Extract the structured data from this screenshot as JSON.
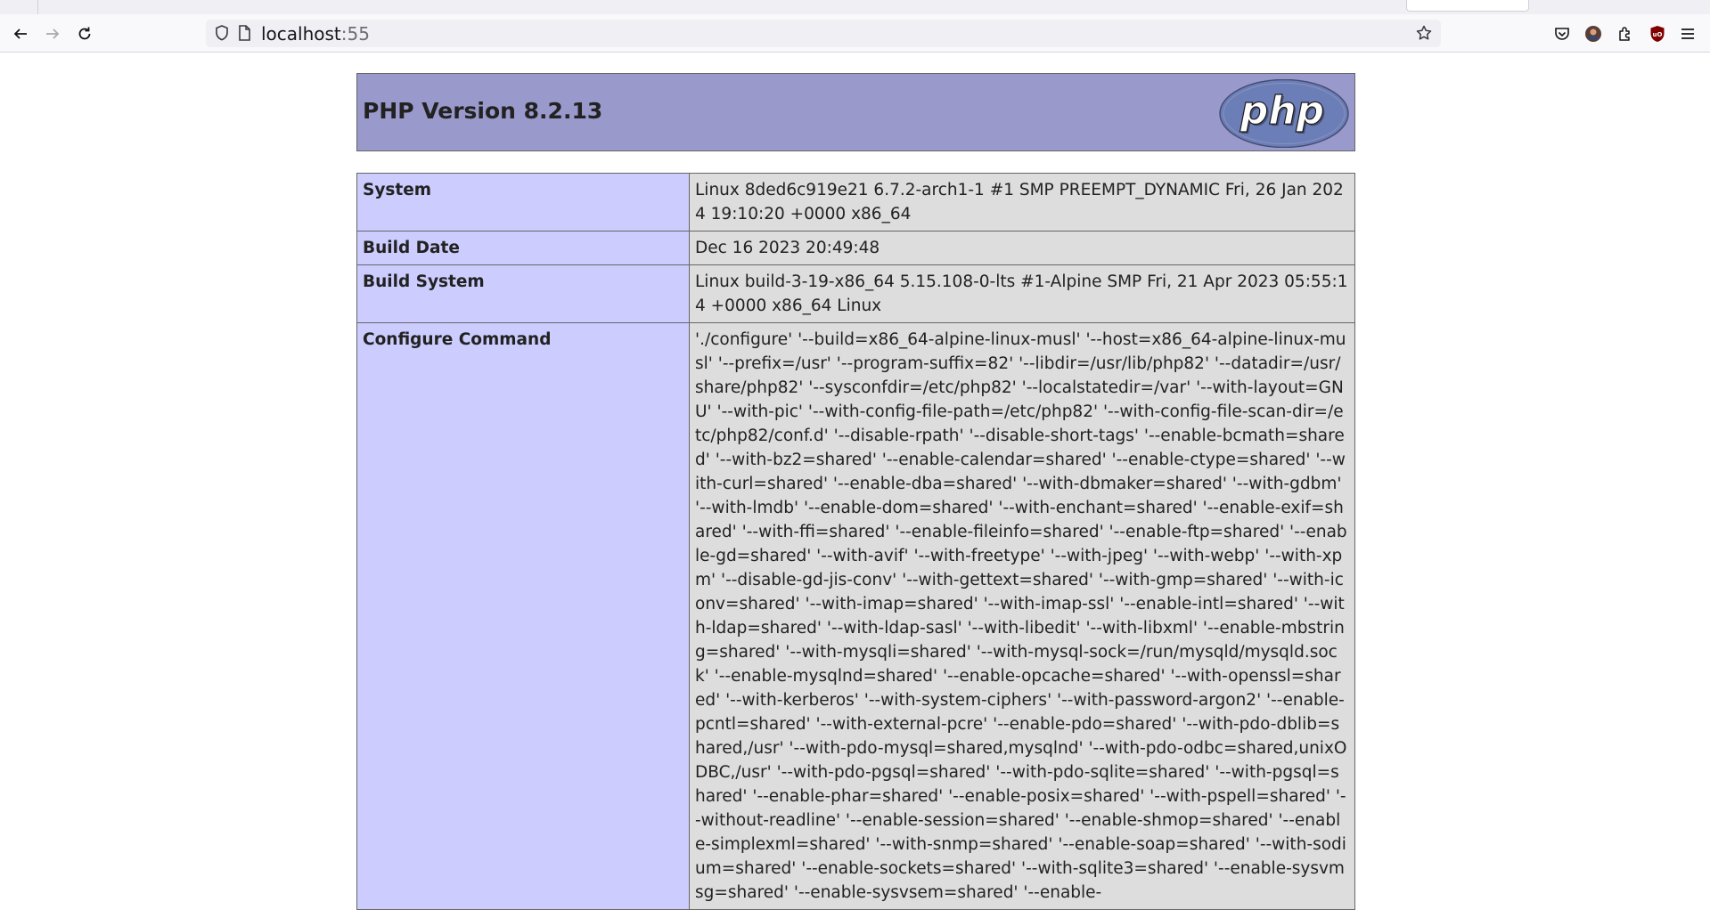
{
  "browser": {
    "url_host": "localhost",
    "url_port": ":55",
    "icons": {
      "back": "arrow-left-icon",
      "forward": "arrow-right-icon",
      "reload": "reload-icon",
      "shield": "tracking-shield-icon",
      "page": "page-info-icon",
      "bookmark": "star-icon",
      "pocket": "pocket-icon",
      "account": "account-avatar-icon",
      "extensions": "extensions-puzzle-icon",
      "ublock": "ublock-origin-icon",
      "menu": "hamburger-menu-icon"
    }
  },
  "phpinfo": {
    "title": "PHP Version 8.2.13",
    "logo_text": "php",
    "colors": {
      "header_bg": "#9999cc",
      "key_bg": "#ccccff",
      "value_bg": "#dddddd",
      "border": "#666666"
    },
    "rows": [
      {
        "key": "System",
        "value": "Linux 8ded6c919e21 6.7.2-arch1-1 #1 SMP PREEMPT_DYNAMIC Fri, 26 Jan 2024 19:10:20 +0000 x86_64"
      },
      {
        "key": "Build Date",
        "value": "Dec 16 2023 20:49:48"
      },
      {
        "key": "Build System",
        "value": "Linux build-3-19-x86_64 5.15.108-0-lts #1-Alpine SMP Fri, 21 Apr 2023 05:55:14 +0000 x86_64 Linux"
      },
      {
        "key": "Configure Command",
        "value": "'./configure' '--build=x86_64-alpine-linux-musl' '--host=x86_64-alpine-linux-musl' '--prefix=/usr' '--program-suffix=82' '--libdir=/usr/lib/php82' '--datadir=/usr/share/php82' '--sysconfdir=/etc/php82' '--localstatedir=/var' '--with-layout=GNU' '--with-pic' '--with-config-file-path=/etc/php82' '--with-config-file-scan-dir=/etc/php82/conf.d' '--disable-rpath' '--disable-short-tags' '--enable-bcmath=shared' '--with-bz2=shared' '--enable-calendar=shared' '--enable-ctype=shared' '--with-curl=shared' '--enable-dba=shared' '--with-dbmaker=shared' '--with-gdbm' '--with-lmdb' '--enable-dom=shared' '--with-enchant=shared' '--enable-exif=shared' '--with-ffi=shared' '--enable-fileinfo=shared' '--enable-ftp=shared' '--enable-gd=shared' '--with-avif' '--with-freetype' '--with-jpeg' '--with-webp' '--with-xpm' '--disable-gd-jis-conv' '--with-gettext=shared' '--with-gmp=shared' '--with-iconv=shared' '--with-imap=shared' '--with-imap-ssl' '--enable-intl=shared' '--with-ldap=shared' '--with-ldap-sasl' '--with-libedit' '--with-libxml' '--enable-mbstring=shared' '--with-mysqli=shared' '--with-mysql-sock=/run/mysqld/mysqld.sock' '--enable-mysqlnd=shared' '--enable-opcache=shared' '--with-openssl=shared' '--with-kerberos' '--with-system-ciphers' '--with-password-argon2' '--enable-pcntl=shared' '--with-external-pcre' '--enable-pdo=shared' '--with-pdo-dblib=shared,/usr' '--with-pdo-mysql=shared,mysqlnd' '--with-pdo-odbc=shared,unixODBC,/usr' '--with-pdo-pgsql=shared' '--with-pdo-sqlite=shared' '--with-pgsql=shared' '--enable-phar=shared' '--enable-posix=shared' '--with-pspell=shared' '--without-readline' '--enable-session=shared' '--enable-shmop=shared' '--enable-simplexml=shared' '--with-snmp=shared' '--enable-soap=shared' '--with-sodium=shared' '--enable-sockets=shared' '--with-sqlite3=shared' '--enable-sysvmsg=shared' '--enable-sysvsem=shared' '--enable-"
      }
    ]
  }
}
